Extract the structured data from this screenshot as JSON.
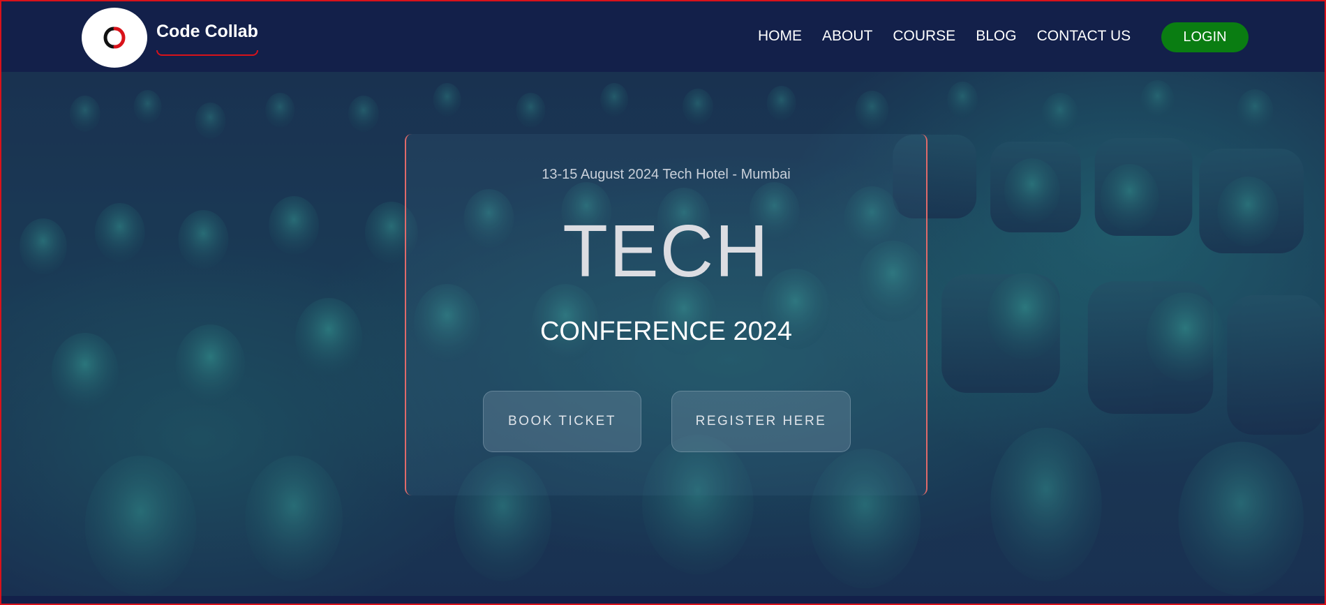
{
  "nav": {
    "brand": "Code Collab",
    "links": [
      "HOME",
      "ABOUT",
      "COURSE",
      "BLOG",
      "CONTACT US"
    ],
    "login_label": "LOGIN"
  },
  "hero": {
    "meta": "13-15 August 2024 Tech Hotel - Mumbai",
    "title": "TECH",
    "subtitle": "CONFERENCE 2024",
    "book_label": "BOOK TICKET",
    "register_label": "REGISTER HERE"
  },
  "colors": {
    "nav_bg": "#13204a",
    "accent_red": "#d9121a",
    "login_green": "#0a7d12",
    "overlay_teal": "#2aa79a"
  },
  "icons": {
    "logo": "double-c-logo-icon"
  }
}
